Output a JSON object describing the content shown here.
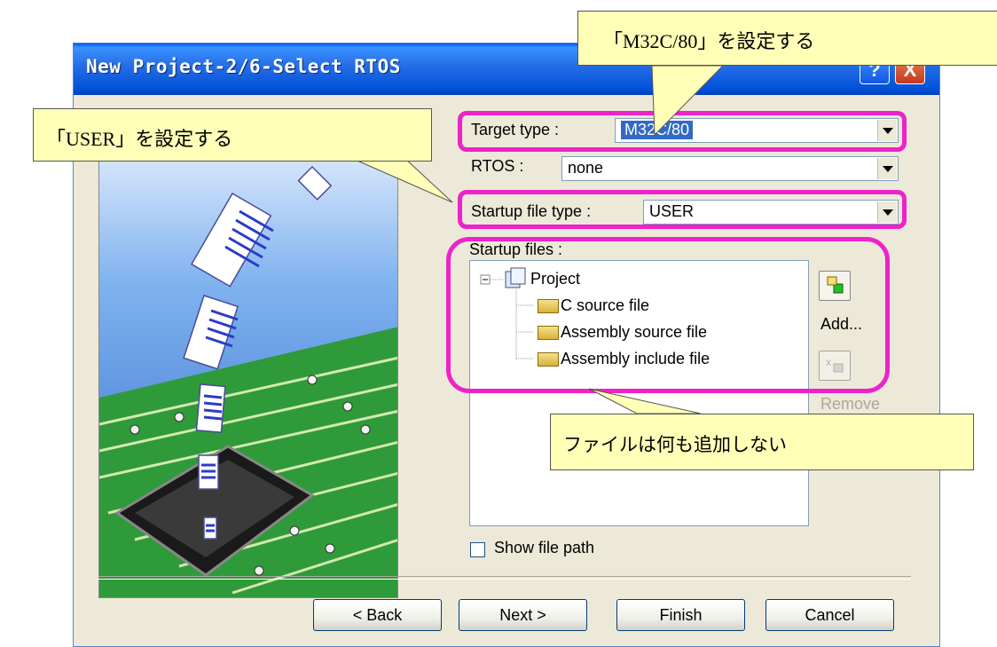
{
  "window": {
    "title": "New Project-2/6-Select RTOS",
    "help_label": "?",
    "close_label": "X"
  },
  "form": {
    "target_type_label": "Target type :",
    "target_type_value": "M32C/80",
    "rtos_label": "RTOS :",
    "rtos_value": "none",
    "startup_type_label": "Startup file type :",
    "startup_type_value": "USER",
    "startup_files_label": "Startup files :"
  },
  "tree": {
    "root": "Project",
    "children": [
      "C source file",
      "Assembly source file",
      "Assembly include file"
    ]
  },
  "side_buttons": {
    "add_label": "Add...",
    "remove_label": "Remove"
  },
  "options": {
    "show_path_label": "Show file path"
  },
  "buttons": {
    "back": "< Back",
    "next": "Next >",
    "finish": "Finish",
    "cancel": "Cancel"
  },
  "callouts": {
    "top": "「M32C/80」を設定する",
    "left": "「USER」を設定する",
    "bottom": "ファイルは何も追加しない"
  },
  "colors": {
    "highlight": "#ee22c9",
    "callout_bg": "#ffffb8",
    "titlebar": "#0058ee"
  }
}
